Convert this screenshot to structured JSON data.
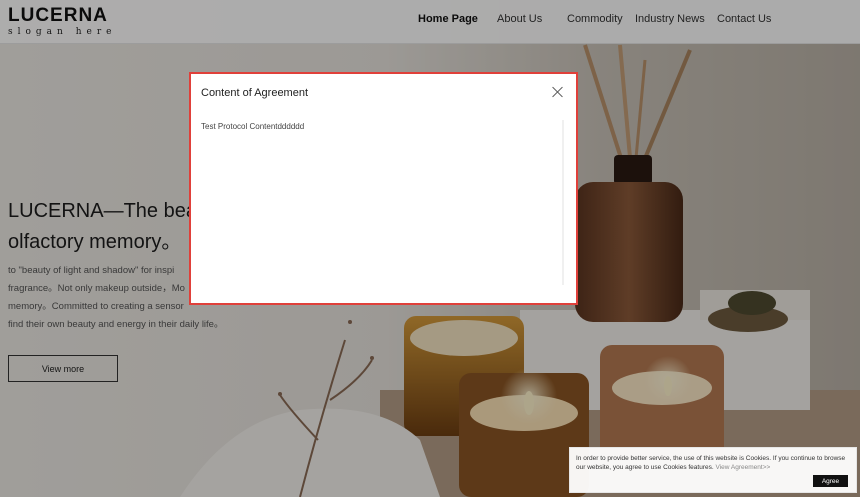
{
  "logo": {
    "title": "LUCERNA",
    "slogan": "slogan here"
  },
  "nav": {
    "items": [
      {
        "label": "Home Page",
        "active": true
      },
      {
        "label": "About Us",
        "active": false
      },
      {
        "label": "Commodity",
        "active": false
      },
      {
        "label": "Industry News",
        "active": false
      },
      {
        "label": "Contact Us",
        "active": false
      }
    ]
  },
  "hero": {
    "title_line1": "LUCERNA—The beaut",
    "title_line2": "olfactory memory。",
    "desc_line1": "to \"beauty of light and shadow\" for inspi",
    "desc_line2": "fragrance。Not only makeup outside，Mo",
    "desc_line3": "memory。Committed to creating a sensor",
    "desc_line4": "find their own beauty and energy in their daily life。",
    "button": "View more"
  },
  "modal": {
    "title": "Content of Agreement",
    "body": "Test Protocol Contentdddddd"
  },
  "cookie": {
    "text": "In order to provide better service, the use of this website is Cookies. If you continue to browse our website, you agree to use Cookies features.",
    "link": "View Agreement>>",
    "button": "Agree"
  },
  "colors": {
    "modal_border": "#e0403a",
    "accent": "#111111"
  }
}
